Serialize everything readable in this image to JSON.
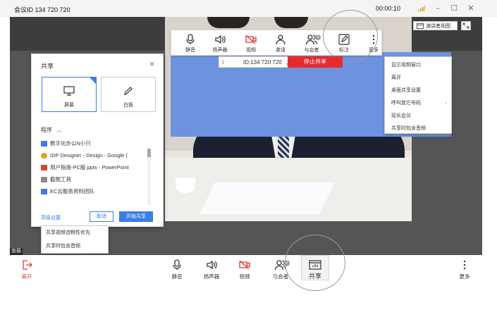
{
  "topbar": {
    "meeting_id": "会议ID 134 720 720",
    "timer": "00:00:10",
    "window_buttons": [
      "minimize-icon",
      "maximize-icon",
      "close-icon"
    ]
  },
  "share_toolbar": {
    "items": [
      {
        "label": "静音",
        "icon": "microphone-icon"
      },
      {
        "label": "扬声器",
        "icon": "speaker-icon"
      },
      {
        "label": "视频",
        "icon": "video-off-icon"
      },
      {
        "label": "邀请",
        "icon": "invite-icon"
      },
      {
        "label": "与会者",
        "icon": "participants-icon",
        "badge": "2"
      },
      {
        "label": "标注",
        "icon": "annotate-pen-icon"
      },
      {
        "label": "更多",
        "icon": "more-vertical-icon"
      }
    ],
    "meeting_id_text": "ID:134 720 720",
    "stop_share": "停止共享"
  },
  "more_menu": {
    "items": [
      {
        "label": "显示视频窗口",
        "submenu": false
      },
      {
        "label": "离开",
        "submenu": false
      },
      {
        "label": "桌面共享设置",
        "submenu": false
      },
      {
        "label": "呼叫其它号码",
        "submenu": true
      },
      {
        "label": "延长会议",
        "submenu": false
      },
      {
        "label": "共享时包含音频",
        "submenu": false
      }
    ]
  },
  "presenter_view": {
    "label": "演讲者视图"
  },
  "share_dialog": {
    "title": "共享",
    "close": "×",
    "tiles": [
      {
        "label": "屏幕",
        "selected": true
      },
      {
        "label": "白板",
        "selected": false
      }
    ],
    "programs_header": "程序",
    "programs": [
      {
        "label": "数字化办公N小只",
        "color": "#3b7ce8"
      },
      {
        "label": "IDP Designer - Design - Google (",
        "color": "#e0a020"
      },
      {
        "label": "用户指南-PC版.pptx - PowerPoint",
        "color": "#d24726"
      },
      {
        "label": "截图工具",
        "color": "#8a8a8a"
      },
      {
        "label": "EC云服务资料团队",
        "color": "#3b7ce8"
      }
    ],
    "advanced_settings": "高级设置",
    "cancel": "取消",
    "start": "开始共享"
  },
  "advanced_menu": {
    "items": [
      "共享视频流畅性优先",
      "共享时包含音频"
    ]
  },
  "user_label": "张振",
  "bottom_toolbar": {
    "leave": "离开",
    "items": [
      {
        "label": "静音",
        "icon": "microphone-icon"
      },
      {
        "label": "扬声器",
        "icon": "speaker-icon"
      },
      {
        "label": "视频",
        "icon": "video-off-icon"
      },
      {
        "label": "与会者",
        "icon": "participants-icon",
        "badge": "2"
      },
      {
        "label": "共享",
        "icon": "share-screen-icon",
        "active": true
      }
    ],
    "more": "更多"
  },
  "colors": {
    "accent": "#3b7ce8",
    "stop_red": "#e52c2c",
    "leave_red": "#e03b3b",
    "shared_blue": "#6d93e0"
  }
}
